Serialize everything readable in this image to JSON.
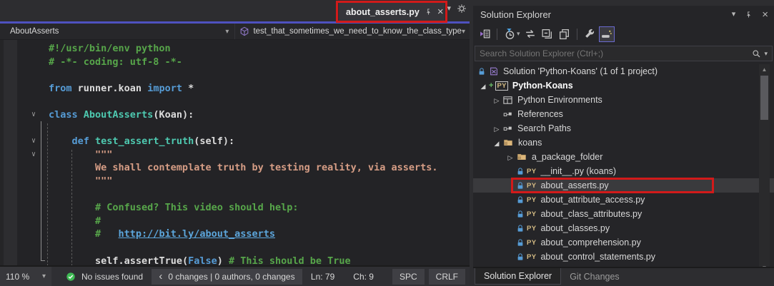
{
  "colors": {
    "accent_purple": "#4e51bf",
    "annotation_red": "#d21a1a",
    "editor_bg": "#232326",
    "selection_bg": "#3a3a3d",
    "comment_green": "#57a64a",
    "keyword_blue": "#569cd6",
    "type_teal": "#4ec9b0",
    "string_orange": "#d69d85",
    "link_blue": "#5ca6dc",
    "lock_blue": "#569cd6",
    "py_yellow": "#d3ba83",
    "folder_tan": "#dcb67a",
    "check_green": "#3fba54"
  },
  "glyphs": {
    "chevron_down": "▾",
    "close": "×",
    "collapsed": "▷",
    "expanded": "◢",
    "back_chevron": "‹",
    "fold_open": "∨"
  },
  "tab_bar": {
    "active_tab": {
      "label": "about_asserts.py"
    }
  },
  "nav_bar": {
    "type_dropdown": "AboutAsserts",
    "member_dropdown": "test_that_sometimes_we_need_to_know_the_class_type"
  },
  "editor": {
    "lines": [
      {
        "segs": [
          {
            "t": "#!/usr/bin/env python",
            "c": "comment"
          }
        ]
      },
      {
        "segs": [
          {
            "t": "# -*- coding: utf-8 -*-",
            "c": "comment"
          }
        ]
      },
      {
        "segs": []
      },
      {
        "segs": [
          {
            "t": "from",
            "c": "kw"
          },
          {
            "t": " ",
            "c": "id"
          },
          {
            "t": "runner.koan",
            "c": "id"
          },
          {
            "t": " ",
            "c": "id"
          },
          {
            "t": "import",
            "c": "kw"
          },
          {
            "t": " *",
            "c": "id"
          }
        ]
      },
      {
        "segs": []
      },
      {
        "fold": true,
        "segs": [
          {
            "t": "class",
            "c": "kw"
          },
          {
            "t": " ",
            "c": "id"
          },
          {
            "t": "AboutAsserts",
            "c": "type"
          },
          {
            "t": "(Koan):",
            "c": "id"
          }
        ]
      },
      {
        "segs": []
      },
      {
        "fold": true,
        "segs": [
          {
            "t": "    ",
            "c": "id"
          },
          {
            "t": "def",
            "c": "kw"
          },
          {
            "t": " ",
            "c": "id"
          },
          {
            "t": "test_assert_truth",
            "c": "type"
          },
          {
            "t": "(self):",
            "c": "id"
          }
        ]
      },
      {
        "fold": true,
        "segs": [
          {
            "t": "        ",
            "c": "id"
          },
          {
            "t": "\"\"\"",
            "c": "str"
          }
        ]
      },
      {
        "segs": [
          {
            "t": "        We shall contemplate truth by testing reality, via asserts.",
            "c": "str"
          }
        ]
      },
      {
        "segs": [
          {
            "t": "        \"\"\"",
            "c": "str"
          }
        ]
      },
      {
        "segs": []
      },
      {
        "segs": [
          {
            "t": "        ",
            "c": "id"
          },
          {
            "t": "# Confused? This video should help:",
            "c": "comment"
          }
        ]
      },
      {
        "segs": [
          {
            "t": "        ",
            "c": "id"
          },
          {
            "t": "#",
            "c": "comment"
          }
        ]
      },
      {
        "segs": [
          {
            "t": "        ",
            "c": "id"
          },
          {
            "t": "#   ",
            "c": "comment"
          },
          {
            "t": "http://bit.ly/about_asserts",
            "c": "link"
          }
        ]
      },
      {
        "segs": []
      },
      {
        "segs": [
          {
            "t": "        ",
            "c": "id"
          },
          {
            "t": "self.",
            "c": "id"
          },
          {
            "t": "assertTrue",
            "c": "id"
          },
          {
            "t": "(",
            "c": "id"
          },
          {
            "t": "False",
            "c": "kw"
          },
          {
            "t": ") ",
            "c": "id"
          },
          {
            "t": "# This should be True",
            "c": "comment"
          }
        ]
      }
    ]
  },
  "status_bar": {
    "zoom": "110 %",
    "issues": "No issues found",
    "git_summary": "0 changes | 0 authors, 0 changes",
    "line": "Ln: 79",
    "column": "Ch: 9",
    "indent_mode": "SPC",
    "line_ending": "CRLF"
  },
  "solution_explorer": {
    "title": "Solution Explorer",
    "search_placeholder": "Search Solution Explorer (Ctrl+;)",
    "toolbar": [
      {
        "name": "switch-views-icon"
      },
      {
        "sep": true
      },
      {
        "name": "pending-changes-filter-icon",
        "dropdown": true
      },
      {
        "name": "sync-with-active-document-icon"
      },
      {
        "name": "collapse-all-icon"
      },
      {
        "name": "show-all-files-icon"
      },
      {
        "sep": true
      },
      {
        "name": "properties-wrench-icon"
      },
      {
        "name": "preview-selected-items-icon",
        "active": true
      }
    ],
    "tree": [
      {
        "level": 0,
        "expander": null,
        "slotIcon": "lock-icon",
        "icons": [
          "solution-icon"
        ],
        "label": "Solution 'Python-Koans' (1 of 1 project)"
      },
      {
        "level": 0,
        "expander": "expanded",
        "icons": [
          "plus-badge",
          "py-badge-boxed"
        ],
        "label": "Python-Koans",
        "bold": true
      },
      {
        "level": 1,
        "expander": "collapsed",
        "icons": [
          "python-environments-icon"
        ],
        "label": "Python Environments"
      },
      {
        "level": 1,
        "expander": null,
        "icons": [
          "references-icon"
        ],
        "label": "References"
      },
      {
        "level": 1,
        "expander": "collapsed",
        "icons": [
          "references-icon"
        ],
        "label": "Search Paths"
      },
      {
        "level": 1,
        "expander": "expanded",
        "icons": [
          "package-folder-icon"
        ],
        "label": "koans"
      },
      {
        "level": 2,
        "expander": "collapsed",
        "icons": [
          "package-folder-icon"
        ],
        "label": "a_package_folder"
      },
      {
        "level": 2,
        "expander": null,
        "icons": [
          "lock-icon",
          "py-badge"
        ],
        "label": "__init__.py (koans)"
      },
      {
        "level": 2,
        "expander": null,
        "icons": [
          "lock-icon",
          "py-badge"
        ],
        "label": "about_asserts.py",
        "selected": true,
        "annotated": true
      },
      {
        "level": 2,
        "expander": null,
        "icons": [
          "lock-icon",
          "py-badge"
        ],
        "label": "about_attribute_access.py"
      },
      {
        "level": 2,
        "expander": null,
        "icons": [
          "lock-icon",
          "py-badge"
        ],
        "label": "about_class_attributes.py"
      },
      {
        "level": 2,
        "expander": null,
        "icons": [
          "lock-icon",
          "py-badge"
        ],
        "label": "about_classes.py"
      },
      {
        "level": 2,
        "expander": null,
        "icons": [
          "lock-icon",
          "py-badge"
        ],
        "label": "about_comprehension.py"
      },
      {
        "level": 2,
        "expander": null,
        "icons": [
          "lock-icon",
          "py-badge"
        ],
        "label": "about_control_statements.py"
      }
    ],
    "bottom_tabs": [
      {
        "label": "Solution Explorer",
        "active": true
      },
      {
        "label": "Git Changes",
        "active": false
      }
    ]
  }
}
